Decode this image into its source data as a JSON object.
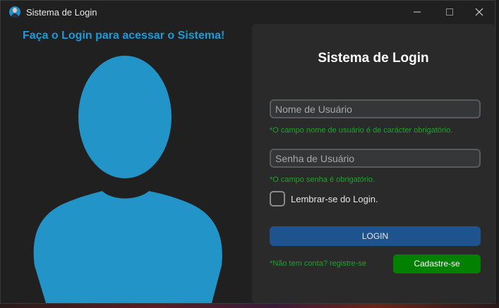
{
  "window": {
    "title": "Sistema de Login",
    "icon": "user-avatar-icon"
  },
  "left": {
    "heading": "Faça o Login para acessar o Sistema!",
    "figure_icon": "user-silhouette-icon",
    "accent_color": "#1f9ad6"
  },
  "form": {
    "title": "Sistema de Login",
    "username": {
      "placeholder": "Nome de Usuário",
      "value": "",
      "hint": "*O campo nome de usuário é de carácter obrigatório."
    },
    "password": {
      "placeholder": "Senha de Usuário",
      "value": "",
      "hint": "*O campo senha é obrigatório."
    },
    "remember": {
      "label": "Lembrar-se do Login.",
      "checked": false
    },
    "login_button": "LOGIN",
    "signup_prompt": "*Não tem conta? registre-se",
    "signup_button": "Cadastre-se",
    "colors": {
      "login": "#1f538d",
      "signup": "#028000",
      "hint": "#1da32c"
    }
  }
}
